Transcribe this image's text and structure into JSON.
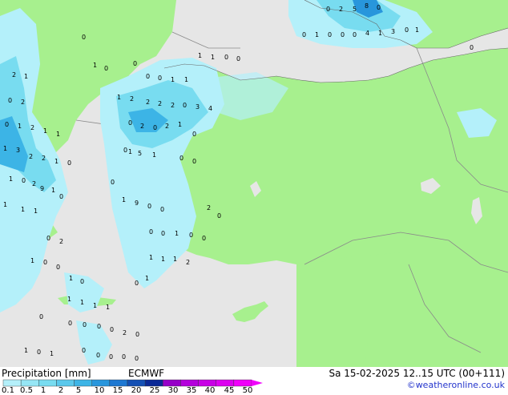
{
  "footer": {
    "title": "Precipitation [mm]",
    "model": "ECMWF",
    "datetime": "Sa 15-02-2025 12..15 UTC (00+111)",
    "credit": "©weatheronline.co.uk"
  },
  "legend": {
    "ticks": [
      "0.1",
      "0.5",
      "1",
      "2",
      "5",
      "10",
      "15",
      "20",
      "25",
      "30",
      "35",
      "40",
      "45",
      "50"
    ],
    "colors": [
      "#b4f0fa",
      "#96e6f5",
      "#78dcf0",
      "#5ac8ec",
      "#3cb4e6",
      "#2896dc",
      "#1e78d2",
      "#1450b4",
      "#0a2896",
      "#9600c8",
      "#b400dc",
      "#c800e6",
      "#dc00f0",
      "#f000fa"
    ]
  },
  "map": {
    "colors": {
      "sea": "#e6e6e6",
      "land": "#a7f08e",
      "precip_light": "#b4f0fa",
      "precip_mid": "#78dcf0",
      "precip_heavy": "#3cb4e6",
      "precip_blue": "#2896dc"
    },
    "values": [
      "0",
      "2",
      "5",
      "8",
      "0",
      "0",
      "1",
      "0",
      "0",
      "0",
      "4",
      "1",
      "3",
      "0",
      "1",
      "0",
      "1",
      "1",
      "0",
      "0",
      "0",
      "1",
      "0",
      "0",
      "0",
      "0",
      "1",
      "1",
      "2",
      "1",
      "0",
      "2",
      "2",
      "2",
      "2",
      "0",
      "3",
      "4",
      "1",
      "2",
      "0",
      "1",
      "2",
      "1",
      "1",
      "0",
      "2",
      "0",
      "2",
      "1",
      "0",
      "0",
      "1",
      "1",
      "3",
      "2",
      "2",
      "1",
      "0",
      "5",
      "1",
      "0",
      "0",
      "1",
      "0",
      "2",
      "9",
      "1",
      "0",
      "0",
      "1",
      "9",
      "0",
      "0",
      "2",
      "0",
      "1",
      "1",
      "1",
      "0",
      "2",
      "0",
      "0",
      "1",
      "0",
      "0",
      "1",
      "0",
      "0",
      "1",
      "1",
      "1",
      "2",
      "1",
      "0",
      "1",
      "0",
      "1",
      "1",
      "1",
      "1",
      "0",
      "0",
      "0",
      "0",
      "0",
      "2",
      "0",
      "1",
      "0",
      "1",
      "0",
      "0",
      "0",
      "0",
      "0",
      "0",
      "1",
      "1"
    ]
  }
}
